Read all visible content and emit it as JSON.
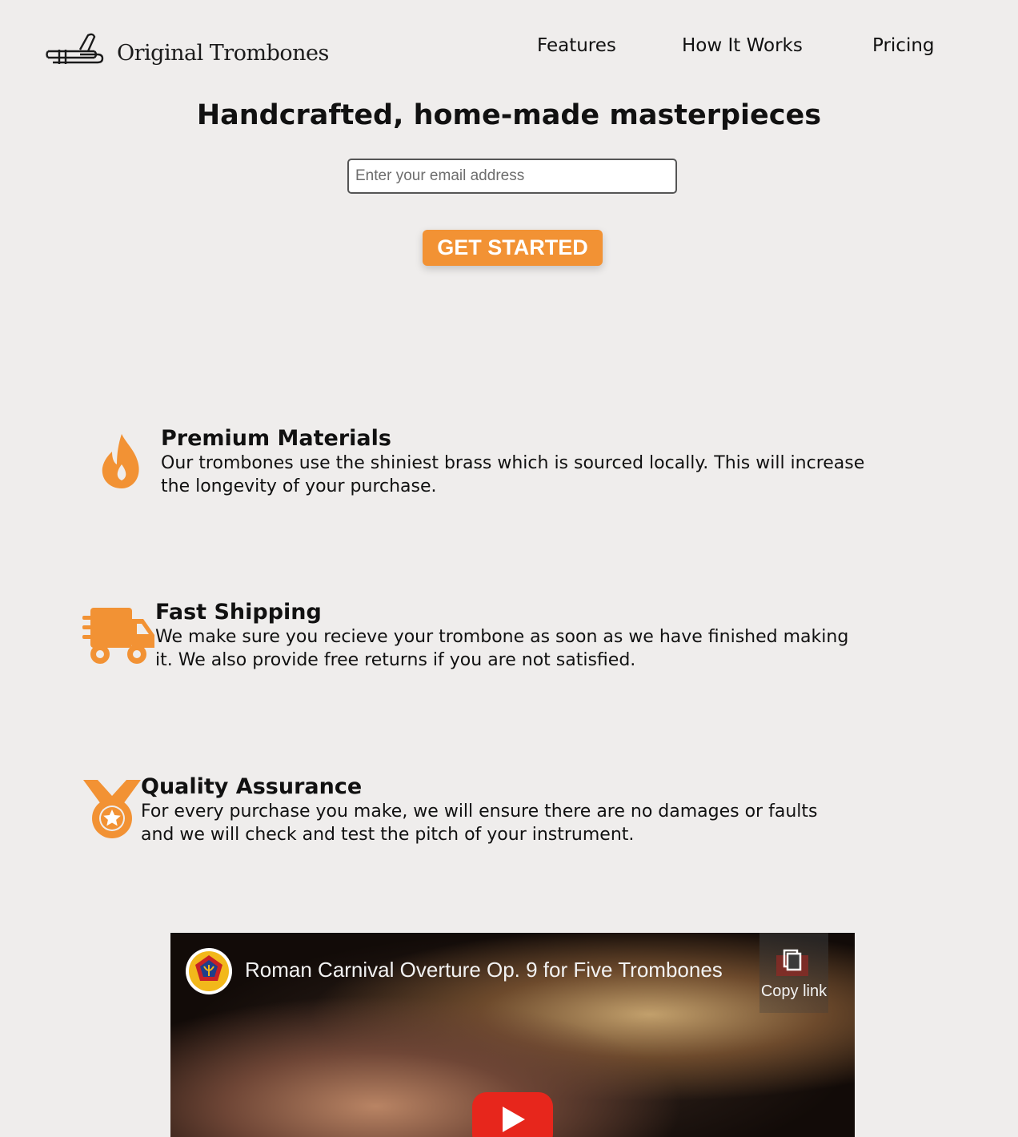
{
  "brand": {
    "name": "Original Trombones",
    "accent_color": "#f29234"
  },
  "nav": {
    "items": [
      "Features",
      "How It Works",
      "Pricing"
    ]
  },
  "hero": {
    "title": "Handcrafted, home-made masterpieces",
    "email_placeholder": "Enter your email address",
    "cta_label": "GET STARTED"
  },
  "features": [
    {
      "icon": "fire-icon",
      "title": "Premium Materials",
      "text": "Our trombones use the shiniest brass which is sourced locally. This will increase the longevity of your purchase."
    },
    {
      "icon": "shipping-truck-icon",
      "title": "Fast Shipping",
      "text": "We make sure you recieve your trombone as soon as we have finished making it. We also provide free returns if you are not satisfied."
    },
    {
      "icon": "medal-icon",
      "title": "Quality Assurance",
      "text": "For every purchase you make, we will ensure there are no damages or faults and we will check and test the pitch of your instrument."
    }
  ],
  "video": {
    "title": "Roman Carnival Overture Op. 9 for Five Trombones",
    "copy_link_label": "Copy link",
    "play_color": "#e7261c"
  }
}
